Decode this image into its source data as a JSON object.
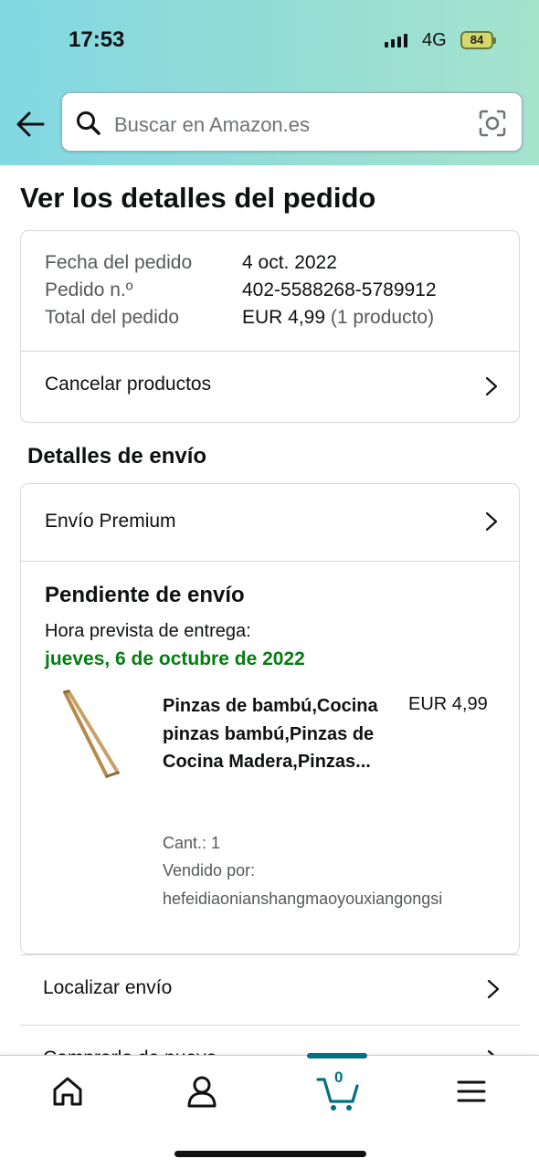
{
  "status_bar": {
    "time": "17:53",
    "network": "4G",
    "battery": "84"
  },
  "search": {
    "placeholder": "Buscar en Amazon.es"
  },
  "page_title": "Ver los detalles del pedido",
  "order_summary": {
    "rows": [
      {
        "label": "Fecha del pedido",
        "value": "4 oct. 2022",
        "extra": ""
      },
      {
        "label": "Pedido n.º",
        "value": "402-5588268-5789912",
        "extra": ""
      },
      {
        "label": "Total del pedido",
        "value": "EUR 4,99",
        "extra": " (1 producto)"
      }
    ],
    "cancel_label": "Cancelar productos"
  },
  "shipping": {
    "section_title": "Detalles de envío",
    "method": "Envío Premium",
    "status_title": "Pendiente de envío",
    "eta_label": "Hora prevista de entrega:",
    "eta_date": "jueves, 6 de octubre de 2022",
    "product": {
      "name": "Pinzas de bambú,Cocina pinzas bambú,Pinzas de Cocina Madera,Pinzas...",
      "price": "EUR 4,99",
      "qty": "Cant.: 1",
      "seller_label": "Vendido por:",
      "seller": "hefeidiaonianshangmaoyouxiangongsi"
    }
  },
  "actions": {
    "track": "Localizar envío",
    "buy_again": "Comprarlo de nuevo"
  },
  "bottom_nav": {
    "cart_count": "0"
  },
  "colors": {
    "accent": "#007185",
    "delivery_green": "#067d12",
    "header_gradient_start": "#82d8e3",
    "header_gradient_end": "#a5e3cd"
  },
  "icons": [
    "arrow-left-icon",
    "search-icon",
    "camera-icon",
    "chevron-right-icon",
    "home-icon",
    "user-icon",
    "cart-icon",
    "menu-icon"
  ]
}
